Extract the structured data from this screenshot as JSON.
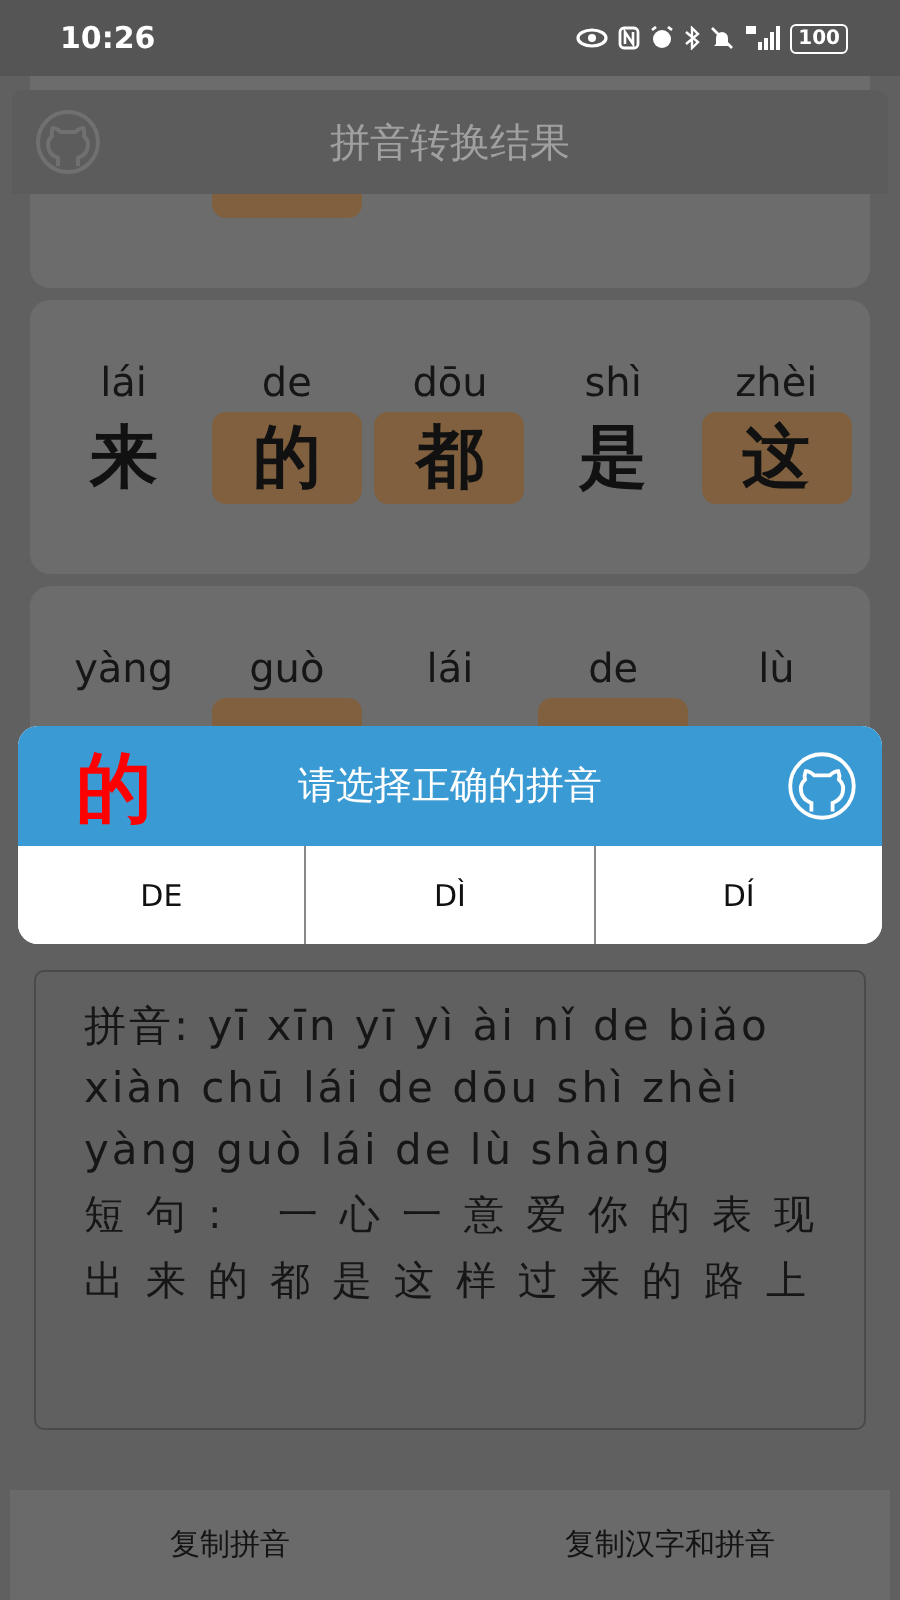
{
  "status_bar": {
    "time": "10:26",
    "battery": "100"
  },
  "header": {
    "title": "拼音转换结果"
  },
  "cards": [
    {
      "chars": [
        {
          "highlighted": false
        },
        {
          "highlighted": true
        },
        {
          "highlighted": false
        },
        {
          "highlighted": false
        },
        {
          "highlighted": false
        }
      ]
    },
    {
      "chars": [
        {
          "pinyin": "lái",
          "hanzi": "来",
          "highlighted": false
        },
        {
          "pinyin": "de",
          "hanzi": "的",
          "highlighted": true
        },
        {
          "pinyin": "dōu",
          "hanzi": "都",
          "highlighted": true
        },
        {
          "pinyin": "shì",
          "hanzi": "是",
          "highlighted": false
        },
        {
          "pinyin": "zhèi",
          "hanzi": "这",
          "highlighted": true
        }
      ]
    },
    {
      "chars": [
        {
          "pinyin": "yàng",
          "highlighted": false
        },
        {
          "pinyin": "guò",
          "highlighted": true
        },
        {
          "pinyin": "lái",
          "highlighted": false
        },
        {
          "pinyin": "de",
          "highlighted": true
        },
        {
          "pinyin": "lù",
          "highlighted": false
        }
      ]
    }
  ],
  "result": {
    "pinyin": "拼音: yī xīn yī yì ài nǐ de biǎo xiàn chū lái de dōu shì zhèi yàng guò lái de lù shàng",
    "sentence": "短句: 一心一意爱你的表现出来的都是这样过来的路上"
  },
  "bottom_buttons": [
    "复制拼音",
    "复制汉字和拼音"
  ],
  "dialog": {
    "character": "的",
    "title": "请选择正确的拼音",
    "options": [
      "DE",
      "DÌ",
      "DÍ"
    ]
  }
}
